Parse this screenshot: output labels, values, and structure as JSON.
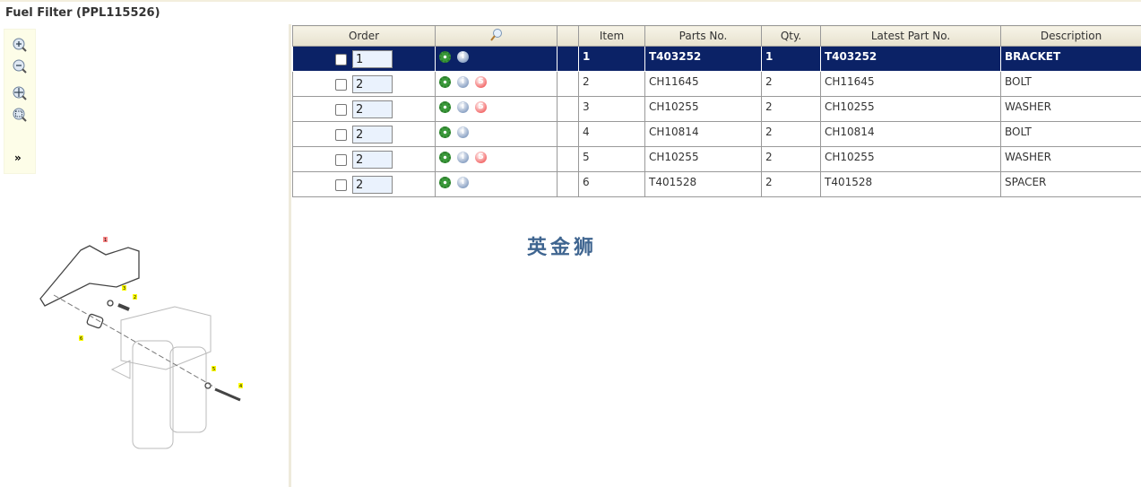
{
  "title": "Fuel Filter (PPL115526)",
  "toolbar": {
    "more": "»"
  },
  "headers": {
    "order": "Order",
    "item": "Item",
    "parts_no": "Parts No.",
    "qty": "Qty.",
    "latest": "Latest Part No.",
    "description": "Description"
  },
  "rows": [
    {
      "qty": "1",
      "item": "1",
      "parts_no": "T403252",
      "q": "1",
      "latest": "T403252",
      "description": "BRACKET",
      "sub": false
    },
    {
      "qty": "2",
      "item": "2",
      "parts_no": "CH11645",
      "q": "2",
      "latest": "CH11645",
      "description": "BOLT",
      "sub": true
    },
    {
      "qty": "2",
      "item": "3",
      "parts_no": "CH10255",
      "q": "2",
      "latest": "CH10255",
      "description": "WASHER",
      "sub": true
    },
    {
      "qty": "2",
      "item": "4",
      "parts_no": "CH10814",
      "q": "2",
      "latest": "CH10814",
      "description": "BOLT",
      "sub": false
    },
    {
      "qty": "2",
      "item": "5",
      "parts_no": "CH10255",
      "q": "2",
      "latest": "CH10255",
      "description": "WASHER",
      "sub": true
    },
    {
      "qty": "2",
      "item": "6",
      "parts_no": "T401528",
      "q": "2",
      "latest": "T401528",
      "description": "SPACER",
      "sub": false
    }
  ],
  "watermark": "英金狮",
  "callouts": [
    "1",
    "2",
    "3",
    "4",
    "5",
    "6"
  ]
}
